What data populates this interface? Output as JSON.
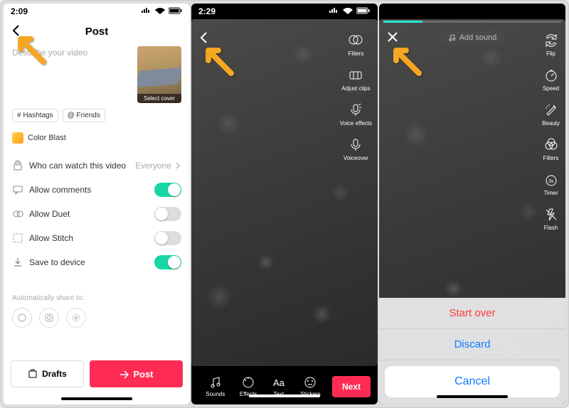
{
  "s1": {
    "time": "2:09",
    "title": "Post",
    "desc_placeholder": "Describe your video",
    "cover_label": "Select cover",
    "chip_hash": "# Hashtags",
    "chip_friends": "@ Friends",
    "effect": "Color Blast",
    "privacy_label": "Who can watch this video",
    "privacy_value": "Everyone",
    "comments": "Allow comments",
    "duet": "Allow Duet",
    "stitch": "Allow Stitch",
    "save": "Save to device",
    "share_label": "Automatically share to:",
    "drafts": "Drafts",
    "post": "Post"
  },
  "s2": {
    "time": "2:29",
    "side": {
      "filters": "Filters",
      "adjust": "Adjust clips",
      "voicefx": "Voice effects",
      "voiceover": "Voiceover"
    },
    "tools": {
      "sounds": "Sounds",
      "effects": "Effects",
      "text": "Text",
      "stickers": "Stickers"
    },
    "next": "Next"
  },
  "s3": {
    "addsound": "Add sound",
    "side": {
      "flip": "Flip",
      "speed": "Speed",
      "beauty": "Beauty",
      "filters": "Filters",
      "timer": "Timer",
      "flash": "Flash"
    },
    "sheet": {
      "start_over": "Start over",
      "discard": "Discard",
      "cancel": "Cancel"
    }
  }
}
